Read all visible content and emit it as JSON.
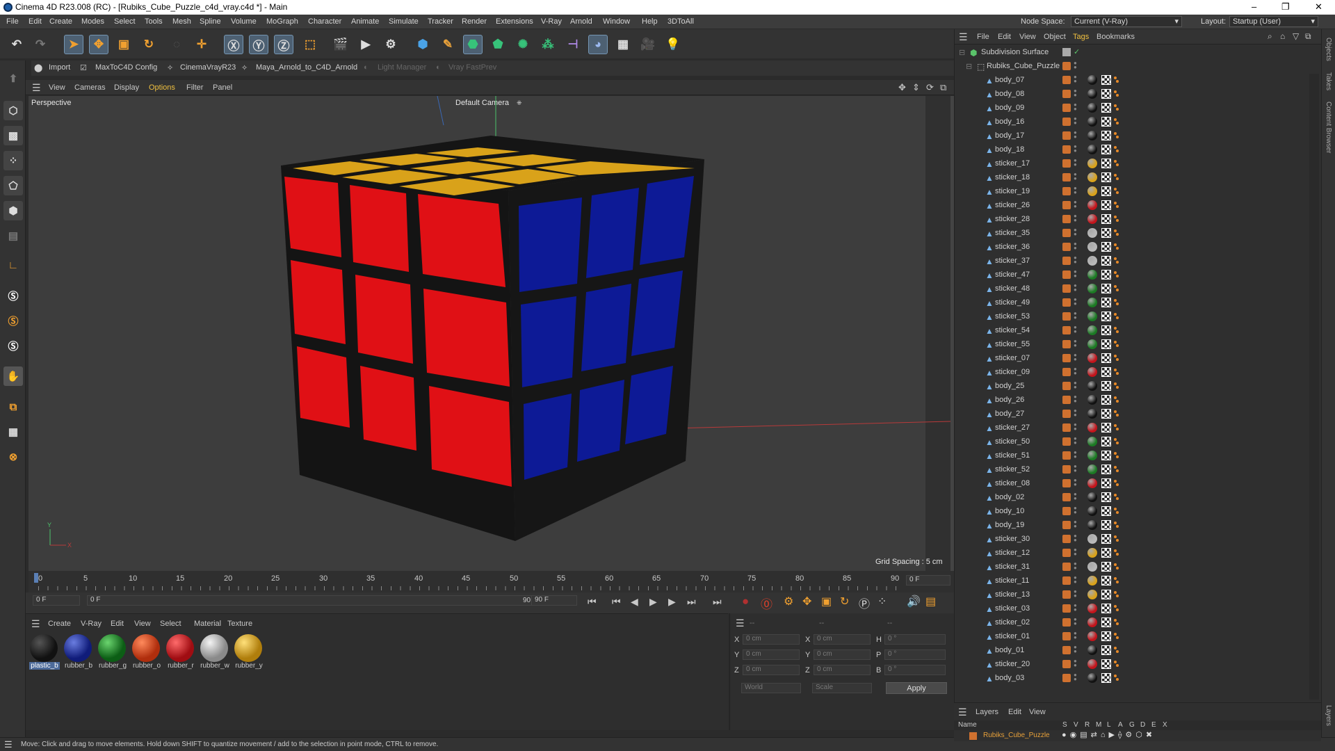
{
  "window": {
    "title": "Cinema 4D R23.008 (RC) - [Rubiks_Cube_Puzzle_c4d_vray.c4d *] - Main",
    "minimize": "–",
    "restore": "❐",
    "close": "✕"
  },
  "menubar": {
    "items": [
      "File",
      "Edit",
      "Create",
      "Modes",
      "Select",
      "Tools",
      "Mesh",
      "Spline",
      "Volume",
      "MoGraph",
      "Character",
      "Animate",
      "Simulate",
      "Tracker",
      "Render",
      "Extensions",
      "V-Ray",
      "Arnold",
      "Window",
      "Help",
      "3DToAll"
    ],
    "node_space_label": "Node Space:",
    "node_space_value": "Current (V-Ray)",
    "layout_label": "Layout:",
    "layout_value": "Startup (User)"
  },
  "plugins": [
    "Import",
    "MaxToC4D Config",
    "CinemaVrayR23",
    "Maya_Arnold_to_C4D_Arnold",
    "Light Manager",
    "Vray FastPrev"
  ],
  "viewport": {
    "menu": [
      "View",
      "Cameras",
      "Display",
      "Options",
      "Filter",
      "Panel"
    ],
    "label": "Perspective",
    "camera": "Default Camera",
    "grid_spacing": "Grid Spacing : 5 cm",
    "axis_y": "Y",
    "axis_x": "X"
  },
  "timeline": {
    "ticks": [
      "0",
      "5",
      "10",
      "15",
      "20",
      "25",
      "30",
      "35",
      "40",
      "45",
      "50",
      "55",
      "60",
      "65",
      "70",
      "75",
      "80",
      "85",
      "90"
    ],
    "current_frame": "0 F"
  },
  "transport": {
    "start": "0 F",
    "slider_start": "0 F",
    "slider_end": "90 F",
    "end": "90 F"
  },
  "materials": {
    "menu": [
      "Create",
      "V-Ray",
      "Edit",
      "View",
      "Select",
      "Material",
      "Texture"
    ],
    "items": [
      {
        "name": "plastic_b",
        "color": "#1b1b1b"
      },
      {
        "name": "rubber_b",
        "color": "#1d2d8c"
      },
      {
        "name": "rubber_g",
        "color": "#1b7a23"
      },
      {
        "name": "rubber_o",
        "color": "#d13a12"
      },
      {
        "name": "rubber_r",
        "color": "#c4141b"
      },
      {
        "name": "rubber_w",
        "color": "#b9b9b9"
      },
      {
        "name": "rubber_y",
        "color": "#d9a21a"
      }
    ]
  },
  "coords": {
    "header": [
      "--",
      "--",
      "--"
    ],
    "rows": [
      {
        "a": "X",
        "av": "0 cm",
        "b": "X",
        "bv": "0 cm",
        "c": "H",
        "cv": "0 °"
      },
      {
        "a": "Y",
        "av": "0 cm",
        "b": "Y",
        "bv": "0 cm",
        "c": "P",
        "cv": "0 °"
      },
      {
        "a": "Z",
        "av": "0 cm",
        "b": "Z",
        "bv": "0 cm",
        "c": "B",
        "cv": "0 °"
      }
    ],
    "mode": "World",
    "size": "Scale",
    "apply": "Apply"
  },
  "status": {
    "text": "Move: Click and drag to move elements. Hold down SHIFT to quantize movement / add to the selection in point mode, CTRL to remove."
  },
  "object_manager": {
    "menu": [
      "File",
      "Edit",
      "View",
      "Object",
      "Tags",
      "Bookmarks"
    ],
    "root": "Subdivision Surface",
    "group": "Rubiks_Cube_Puzzle",
    "objects": [
      {
        "name": "body_07",
        "mat": "#111"
      },
      {
        "name": "body_08",
        "mat": "#111"
      },
      {
        "name": "body_09",
        "mat": "#111"
      },
      {
        "name": "body_16",
        "mat": "#111"
      },
      {
        "name": "body_17",
        "mat": "#111"
      },
      {
        "name": "body_18",
        "mat": "#111"
      },
      {
        "name": "sticker_17",
        "mat": "#d9a21a"
      },
      {
        "name": "sticker_18",
        "mat": "#d9a21a"
      },
      {
        "name": "sticker_19",
        "mat": "#d9a21a"
      },
      {
        "name": "sticker_26",
        "mat": "#c4141b"
      },
      {
        "name": "sticker_28",
        "mat": "#c4141b"
      },
      {
        "name": "sticker_35",
        "mat": "#b9b9b9"
      },
      {
        "name": "sticker_36",
        "mat": "#b9b9b9"
      },
      {
        "name": "sticker_37",
        "mat": "#b9b9b9"
      },
      {
        "name": "sticker_47",
        "mat": "#1b7a23"
      },
      {
        "name": "sticker_48",
        "mat": "#1b7a23"
      },
      {
        "name": "sticker_49",
        "mat": "#1b7a23"
      },
      {
        "name": "sticker_53",
        "mat": "#1b7a23"
      },
      {
        "name": "sticker_54",
        "mat": "#1b7a23"
      },
      {
        "name": "sticker_55",
        "mat": "#1b7a23"
      },
      {
        "name": "sticker_07",
        "mat": "#c4141b"
      },
      {
        "name": "sticker_09",
        "mat": "#c4141b"
      },
      {
        "name": "body_25",
        "mat": "#111"
      },
      {
        "name": "body_26",
        "mat": "#111"
      },
      {
        "name": "body_27",
        "mat": "#111"
      },
      {
        "name": "sticker_27",
        "mat": "#c4141b"
      },
      {
        "name": "sticker_50",
        "mat": "#1b7a23"
      },
      {
        "name": "sticker_51",
        "mat": "#1b7a23"
      },
      {
        "name": "sticker_52",
        "mat": "#1b7a23"
      },
      {
        "name": "sticker_08",
        "mat": "#c4141b"
      },
      {
        "name": "body_02",
        "mat": "#111"
      },
      {
        "name": "body_10",
        "mat": "#111"
      },
      {
        "name": "body_19",
        "mat": "#111"
      },
      {
        "name": "sticker_30",
        "mat": "#b9b9b9"
      },
      {
        "name": "sticker_12",
        "mat": "#d9a21a"
      },
      {
        "name": "sticker_31",
        "mat": "#b9b9b9"
      },
      {
        "name": "sticker_11",
        "mat": "#d9a21a"
      },
      {
        "name": "sticker_13",
        "mat": "#d9a21a"
      },
      {
        "name": "sticker_03",
        "mat": "#c4141b"
      },
      {
        "name": "sticker_02",
        "mat": "#c4141b"
      },
      {
        "name": "sticker_01",
        "mat": "#c4141b"
      },
      {
        "name": "body_01",
        "mat": "#111"
      },
      {
        "name": "sticker_20",
        "mat": "#c4141b"
      },
      {
        "name": "body_03",
        "mat": "#111"
      }
    ]
  },
  "right_tabs": [
    "Objects",
    "Takes",
    "Content Browser",
    "Layers"
  ],
  "layers": {
    "menu": [
      "Layers",
      "Edit",
      "View"
    ],
    "name_col": "Name",
    "flags": [
      "S",
      "V",
      "R",
      "M",
      "L",
      "A",
      "G",
      "D",
      "E",
      "X"
    ],
    "layer_name": "Rubiks_Cube_Puzzle"
  }
}
